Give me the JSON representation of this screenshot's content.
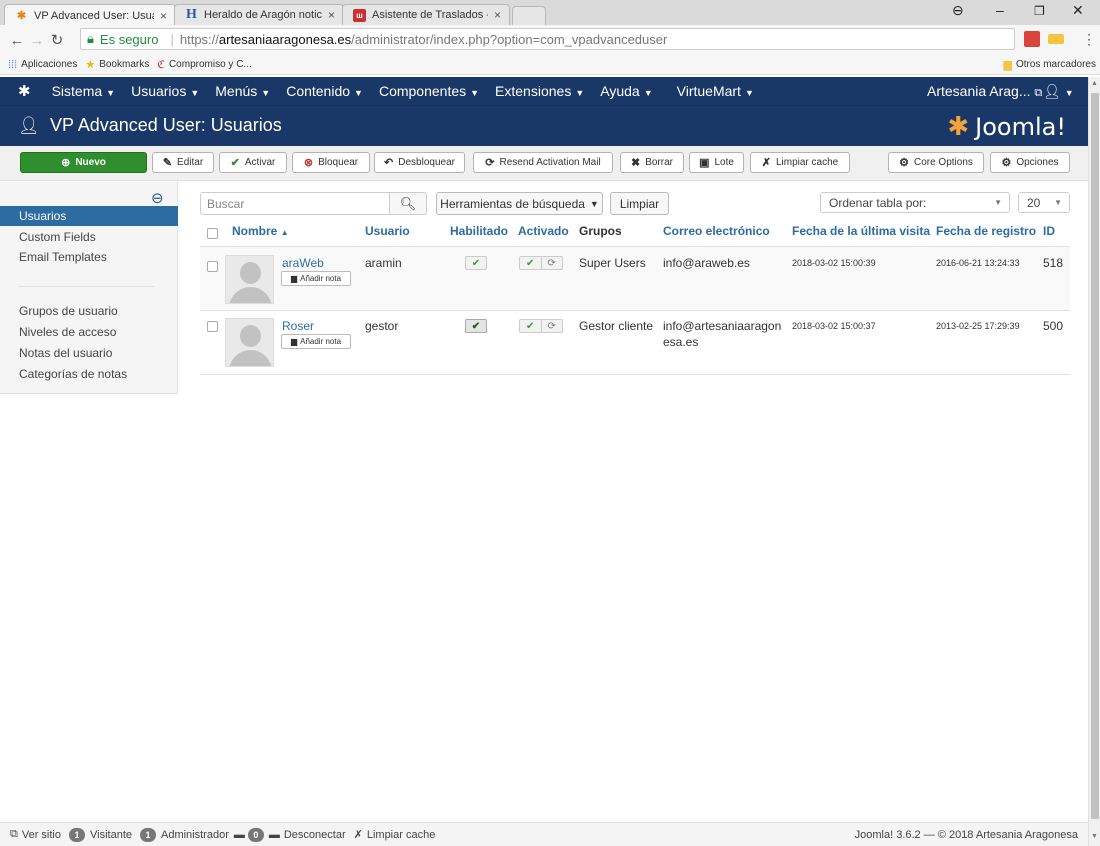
{
  "browser": {
    "tabs": [
      {
        "title": "VP Advanced User: Usuar",
        "favicon": "joomla-favicon"
      },
      {
        "title": "Heraldo de Aragón notic",
        "favicon": "heraldo-favicon"
      },
      {
        "title": "Asistente de Traslados - ",
        "favicon": "asistente-favicon"
      }
    ],
    "secure_label": "Es seguro",
    "url_scheme": "https://",
    "url_host": "artesaniaaragonesa.es",
    "url_path": "/administrator/index.php?option=com_vpadvanceduser",
    "bookmarks": [
      {
        "label": "Aplicaciones",
        "icon": "apps-grid-icon"
      },
      {
        "label": "Bookmarks",
        "icon": "star-icon"
      },
      {
        "label": "Compromiso y C...",
        "icon": "compromiso-icon"
      }
    ],
    "other_bookmarks": "Otros marcadores"
  },
  "topnav": {
    "items": [
      "Sistema",
      "Usuarios",
      "Menús",
      "Contenido",
      "Componentes",
      "Extensiones",
      "Ayuda",
      "VirtueMart"
    ],
    "site_name": "Artesania Arag...",
    "external_icon": "external-link-icon",
    "user_icon": "user-icon"
  },
  "header": {
    "title": "VP Advanced User: Usuarios",
    "brand": "Joomla!"
  },
  "toolbar": {
    "nuevo": "Nuevo",
    "editar": "Editar",
    "activar": "Activar",
    "bloquear": "Bloquear",
    "desbloquear": "Desbloquear",
    "resend": "Resend Activation Mail",
    "borrar": "Borrar",
    "lote": "Lote",
    "limpiar_cache": "Limpiar cache",
    "core_options": "Core Options",
    "opciones": "Opciones"
  },
  "sidebar": {
    "items": [
      "Usuarios",
      "Custom Fields",
      "Email Templates"
    ],
    "items2": [
      "Grupos de usuario",
      "Niveles de acceso",
      "Notas del usuario",
      "Categorías de notas"
    ]
  },
  "filters": {
    "search_placeholder": "Buscar",
    "search_tools": "Herramientas de búsqueda",
    "clear": "Limpiar",
    "order_by": "Ordenar tabla por:",
    "limit": "20"
  },
  "table": {
    "headers": {
      "nombre": "Nombre",
      "usuario": "Usuario",
      "habilitado": "Habilitado",
      "activado": "Activado",
      "grupos": "Grupos",
      "correo": "Correo electrónico",
      "ultima_visita": "Fecha de la última visita",
      "registro": "Fecha de registro",
      "id": "ID"
    },
    "add_note": "Añadir nota",
    "rows": [
      {
        "name": "araWeb",
        "username": "aramin",
        "group": "Super Users",
        "email": "info@araweb.es",
        "email2": "",
        "last_visit": "2018-03-02 15:00:39",
        "registered": "2016-06-21 13:24:33",
        "id": "518"
      },
      {
        "name": "Roser",
        "username": "gestor",
        "group": "Gestor cliente",
        "email": "info@artesaniaaragon",
        "email2": "esa.es",
        "last_visit": "2018-03-02 15:00:37",
        "registered": "2013-02-25 17:29:39",
        "id": "500"
      }
    ]
  },
  "statusbar": {
    "ver_sitio": "Ver sitio",
    "visitors_count": "1",
    "visitors": "Visitante",
    "admins_count": "1",
    "admins": "Administrador",
    "messages_count": "0",
    "logout": "Desconectar",
    "clear_cache": "Limpiar cache",
    "copyright": "Joomla! 3.6.2 — © 2018 Artesania Aragonesa"
  },
  "colors": {
    "navy": "#1a3867",
    "primary": "#2d6ca2",
    "success": "#2f8f2f"
  }
}
